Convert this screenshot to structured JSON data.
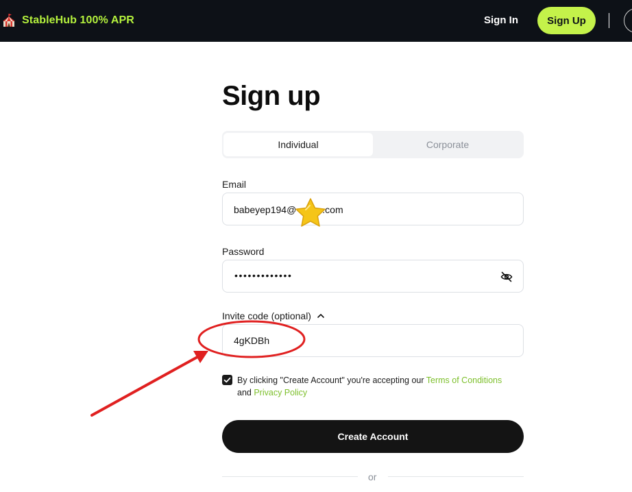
{
  "header": {
    "brand": "StableHub 100% APR",
    "sign_in": "Sign In",
    "sign_up": "Sign Up"
  },
  "form": {
    "title": "Sign up",
    "tabs": [
      {
        "label": "Individual",
        "active": true
      },
      {
        "label": "Corporate",
        "active": false
      }
    ],
    "email": {
      "label": "Email",
      "value_prefix": "babeyep194@",
      "value_suffix": ".com"
    },
    "password": {
      "label": "Password",
      "masked_value": "•••••••••••••"
    },
    "invite": {
      "label": "Invite code (optional)",
      "value": "4gKDBh"
    },
    "terms": {
      "checked": true,
      "text_before": "By clicking \"Create Account\" you're accepting our ",
      "terms_link": "Terms of Conditions",
      "text_and": "and ",
      "privacy_link": "Privacy Policy"
    },
    "submit": "Create Account",
    "divider_text": "or"
  },
  "colors": {
    "header_bg": "#0d1117",
    "brand_green": "#b5f23d",
    "signup_button": "#c4f24a",
    "link_green": "#7cbf2a",
    "annotation_red": "#e02020",
    "annotation_star": "#f5c518"
  },
  "icons": {
    "brand": "tent-icon",
    "password_toggle": "eye-slash-icon",
    "invite_toggle": "chevron-up-icon",
    "checkbox": "check-icon"
  }
}
